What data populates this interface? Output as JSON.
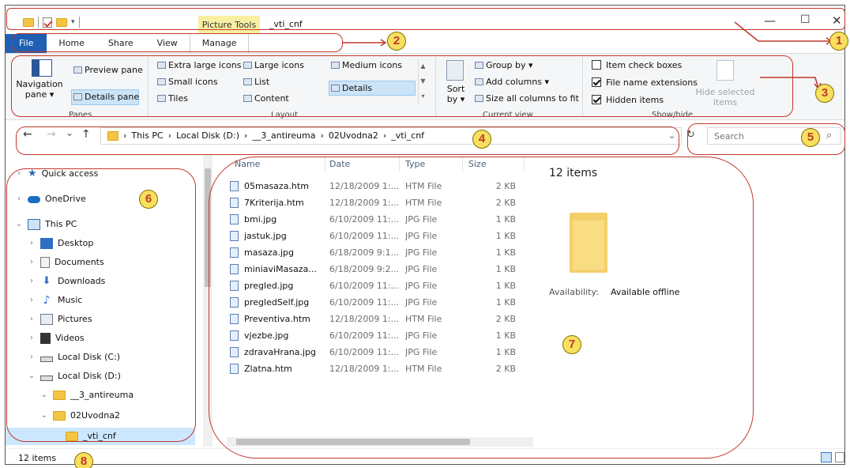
{
  "window": {
    "context_tab": "Picture Tools",
    "title": "_vti_cnf",
    "controls": {
      "minimize": "—",
      "maximize": "☐",
      "close": "✕"
    }
  },
  "tabs": [
    "File",
    "Home",
    "Share",
    "View",
    "Manage"
  ],
  "ribbon": {
    "panes": {
      "navigation_pane": "Navigation",
      "navigation_pane_sub": "pane ▾",
      "preview_pane": "Preview pane",
      "details_pane": "Details pane",
      "group": "Panes"
    },
    "layout": {
      "extra_large_icons": "Extra large icons",
      "large_icons": "Large icons",
      "medium_icons": "Medium icons",
      "small_icons": "Small icons",
      "list": "List",
      "details": "Details",
      "tiles": "Tiles",
      "content": "Content",
      "group": "Layout"
    },
    "current_view": {
      "sort_by": "Sort",
      "sort_by_sub": "by ▾",
      "group_by": "Group by ▾",
      "add_columns": "Add columns ▾",
      "size_all_columns": "Size all columns to fit",
      "group": "Current view"
    },
    "show_hide": {
      "item_check_boxes": "Item check boxes",
      "file_name_extensions": "File name extensions",
      "hidden_items": "Hidden items",
      "hide_selected": "Hide selected",
      "hide_selected_sub": "items",
      "group": "Show/hide"
    }
  },
  "address": {
    "back": "←",
    "forward": "→",
    "recent": "⌄",
    "up": "↑",
    "crumbs": [
      "This PC",
      "Local Disk (D:)",
      "__3_antireuma",
      "02Uvodna2",
      "_vti_cnf"
    ],
    "separator": "›",
    "refresh": "↻",
    "search_placeholder": "Search",
    "search_icon": "⌕"
  },
  "nav": {
    "items": [
      {
        "label": "Quick access",
        "icon": "star-icon"
      },
      {
        "label": "OneDrive",
        "icon": "cloud-icon"
      },
      {
        "label": "This PC",
        "icon": "computer-icon"
      },
      {
        "label": "Desktop",
        "icon": "desktop-icon"
      },
      {
        "label": "Documents",
        "icon": "documents-icon"
      },
      {
        "label": "Downloads",
        "icon": "download-icon"
      },
      {
        "label": "Music",
        "icon": "music-icon"
      },
      {
        "label": "Pictures",
        "icon": "pictures-icon"
      },
      {
        "label": "Videos",
        "icon": "videos-icon"
      },
      {
        "label": "Local Disk (C:)",
        "icon": "drive-icon"
      },
      {
        "label": "Local Disk (D:)",
        "icon": "drive-icon"
      },
      {
        "label": "__3_antireuma",
        "icon": "folder-icon"
      },
      {
        "label": "02Uvodna2",
        "icon": "folder-icon"
      },
      {
        "label": "_vti_cnf",
        "icon": "folder-icon"
      }
    ]
  },
  "list": {
    "columns": [
      "Name",
      "Date",
      "Type",
      "Size"
    ],
    "files": [
      {
        "name": "05masaza.htm",
        "date": "12/18/2009 1:...",
        "type": "HTM File",
        "size": "2 KB"
      },
      {
        "name": "7Kriterija.htm",
        "date": "12/18/2009 1:...",
        "type": "HTM File",
        "size": "2 KB"
      },
      {
        "name": "bmi.jpg",
        "date": "6/10/2009 11:...",
        "type": "JPG File",
        "size": "1 KB"
      },
      {
        "name": "jastuk.jpg",
        "date": "6/10/2009 11:...",
        "type": "JPG File",
        "size": "1 KB"
      },
      {
        "name": "masaza.jpg",
        "date": "6/18/2009 9:1...",
        "type": "JPG File",
        "size": "1 KB"
      },
      {
        "name": "miniaviMasaza...",
        "date": "6/18/2009 9:2...",
        "type": "JPG File",
        "size": "1 KB"
      },
      {
        "name": "pregled.jpg",
        "date": "6/10/2009 11:...",
        "type": "JPG File",
        "size": "1 KB"
      },
      {
        "name": "pregledSelf.jpg",
        "date": "6/10/2009 11:...",
        "type": "JPG File",
        "size": "1 KB"
      },
      {
        "name": "Preventiva.htm",
        "date": "12/18/2009 1:...",
        "type": "HTM File",
        "size": "2 KB"
      },
      {
        "name": "vjezbe.jpg",
        "date": "6/10/2009 11:...",
        "type": "JPG File",
        "size": "1 KB"
      },
      {
        "name": "zdravaHrana.jpg",
        "date": "6/10/2009 11:...",
        "type": "JPG File",
        "size": "1 KB"
      },
      {
        "name": "Zlatna.htm",
        "date": "12/18/2009 1:...",
        "type": "HTM File",
        "size": "2 KB"
      }
    ]
  },
  "preview": {
    "count": "12 items",
    "availability_label": "Availability:",
    "availability_value": "Available offline"
  },
  "status": {
    "count": "12 items"
  },
  "annotations": [
    "1",
    "2",
    "3",
    "4",
    "5",
    "6",
    "7",
    "8"
  ],
  "colors": {
    "annotation": "#c0392b",
    "badge": "#f6e05e",
    "file_tab": "#1f5fb4",
    "selection": "#cce8ff"
  }
}
